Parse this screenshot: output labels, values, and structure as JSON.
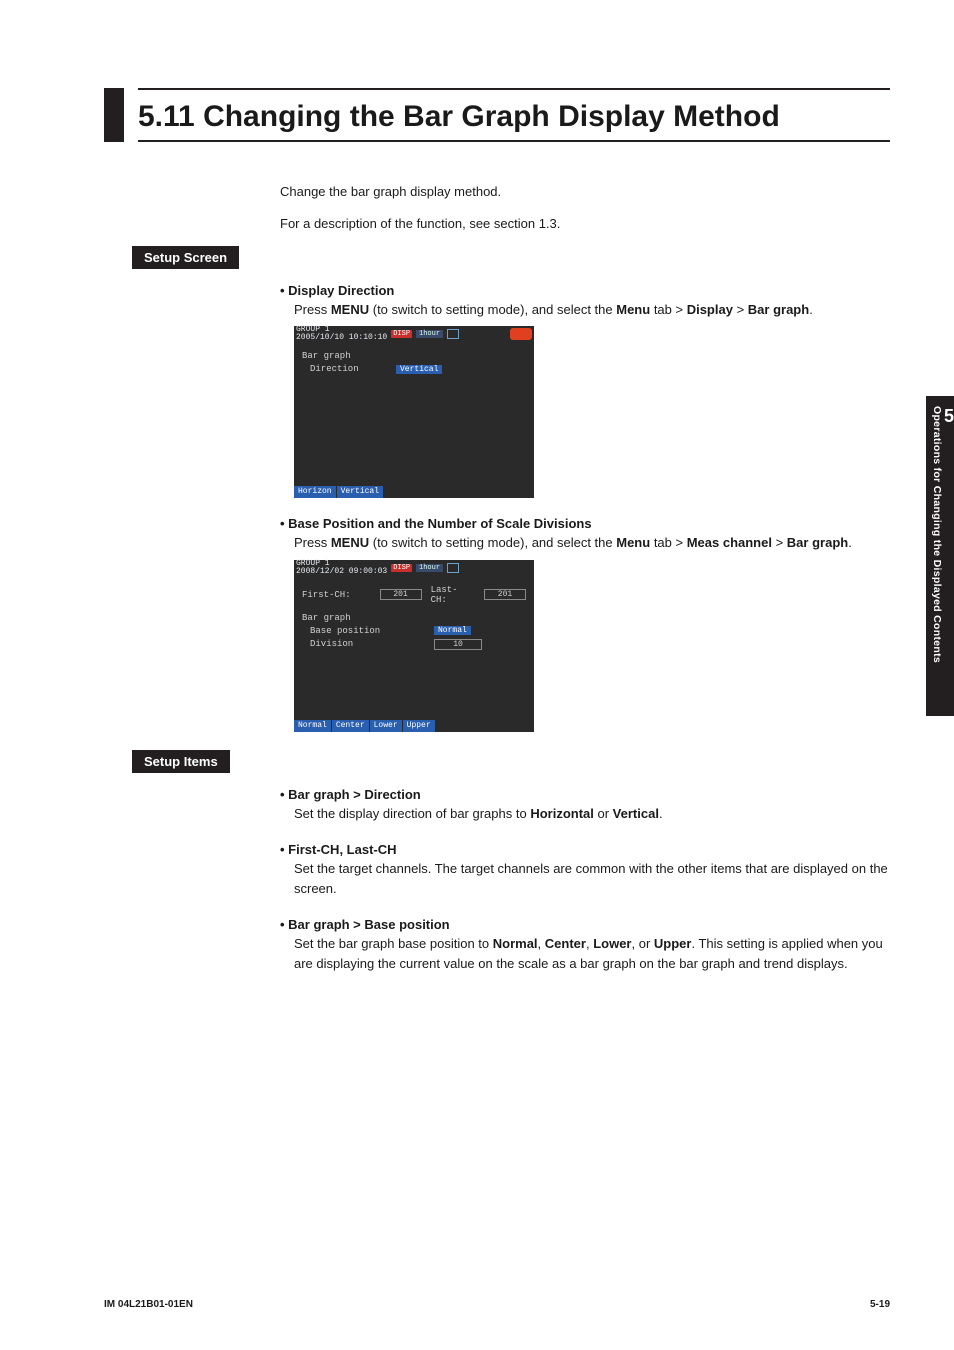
{
  "heading": "5.11   Changing the Bar Graph Display Method",
  "intro": {
    "line1": "Change the bar graph display method.",
    "line2": "For a description of the function, see section 1.3."
  },
  "section_labels": {
    "setup_screen": "Setup Screen",
    "setup_items": "Setup Items"
  },
  "display_direction": {
    "title": "Display Direction",
    "body_a": "Press ",
    "body_menu": "MENU",
    "body_b": " (to switch to setting mode), and select the ",
    "body_menu2": "Menu",
    "body_c": " tab > ",
    "body_display": "Display",
    "body_d": " > ",
    "body_bargraph": "Bar graph",
    "body_e": "."
  },
  "screen1": {
    "group": "GROUP 1",
    "timestamp": "2005/10/10 10:10:10",
    "disp": "DISP",
    "hour": "1hour",
    "row1": "Bar graph",
    "row2_lbl": "Direction",
    "row2_val": "Vertical",
    "footer": [
      "Horizon",
      "Vertical"
    ]
  },
  "base_position": {
    "title": "Base Position and the Number of Scale Divisions",
    "body_a": "Press ",
    "body_menu": "MENU",
    "body_b": " (to switch to setting mode), and select the ",
    "body_menu2": "Menu",
    "body_c": " tab > ",
    "body_meas": "Meas channel",
    "body_d": " > ",
    "body_bargraph": "Bar graph",
    "body_e": "."
  },
  "screen2": {
    "group": "GROUP 1",
    "timestamp": "2008/12/02 09:00:03",
    "disp": "DISP",
    "hour": "1hour",
    "firstch_lbl": "First-CH:",
    "firstch_val": "201",
    "lastch_lbl": "Last-CH:",
    "lastch_val": "201",
    "row_bg": "Bar graph",
    "row_bp_lbl": "Base position",
    "row_bp_val": "Normal",
    "row_div_lbl": "Division",
    "row_div_val": "10",
    "footer": [
      "Normal",
      "Center",
      "Lower",
      "Upper"
    ]
  },
  "items": {
    "direction": {
      "title": "Bar graph > Direction",
      "body_a": "Set the display direction of bar graphs to ",
      "horiz": "Horizontal",
      "or": " or ",
      "vert": "Vertical",
      "end": "."
    },
    "firstlast": {
      "title": "First-CH, Last-CH",
      "body": "Set the target channels. The target channels are common with the other items that are displayed on the screen."
    },
    "basepos": {
      "title": "Bar graph > Base position",
      "body_a": "Set the bar graph base position to ",
      "n": "Normal",
      "c": "Center",
      "l": "Lower",
      "u": "Upper",
      "sep": ", ",
      "or": ", or ",
      "end": ". This setting is applied when you are displaying the current value on the scale as a bar graph on the bar graph and trend displays."
    }
  },
  "side_tab": {
    "chapter": "5",
    "title": "Operations for Changing the Displayed Contents"
  },
  "footer": {
    "left": "IM 04L21B01-01EN",
    "right": "5-19"
  }
}
